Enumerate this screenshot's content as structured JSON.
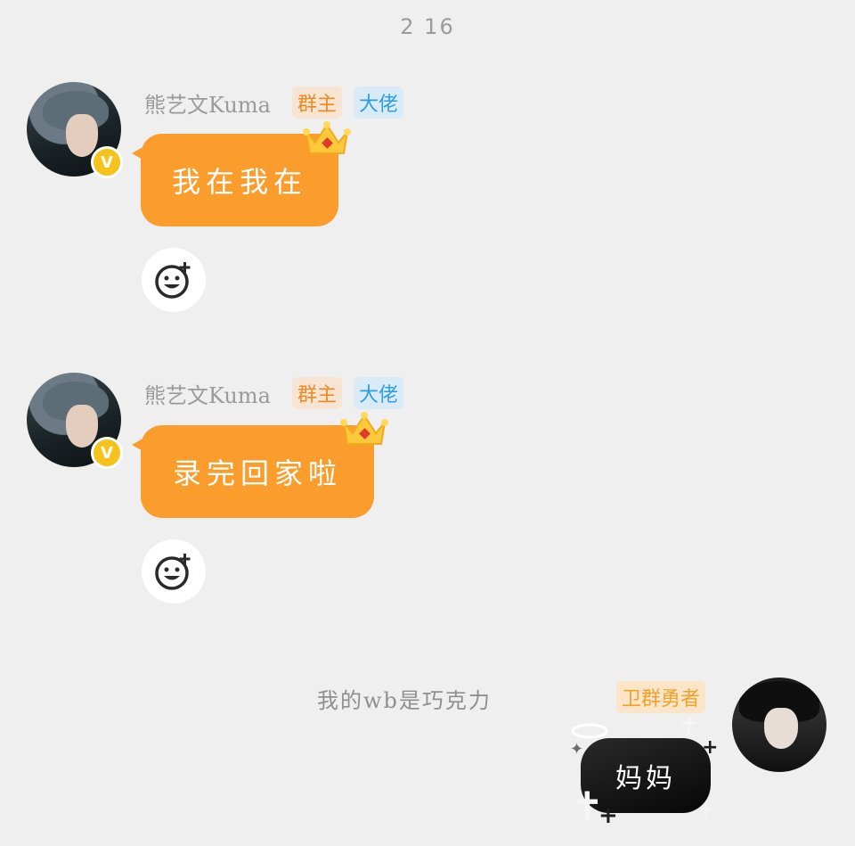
{
  "timestamp": "2 16",
  "messages": [
    {
      "sender": "熊艺文Kuma",
      "tags": [
        "群主",
        "大佬"
      ],
      "text": "我在我在"
    },
    {
      "sender": "熊艺文Kuma",
      "tags": [
        "群主",
        "大佬"
      ],
      "text": "录完回家啦"
    }
  ],
  "self_message": {
    "sender": "我的wb是巧克力",
    "tag": "卫群勇者",
    "text": "妈妈"
  },
  "icons": {
    "verified": "V",
    "react": "add-reaction-icon",
    "crown": "crown-icon"
  },
  "colors": {
    "bubble": "#fb9d2c",
    "owner_tag": "#ee8a24",
    "big_tag": "#2f9ee0",
    "hero_tag": "#f0a22b"
  }
}
